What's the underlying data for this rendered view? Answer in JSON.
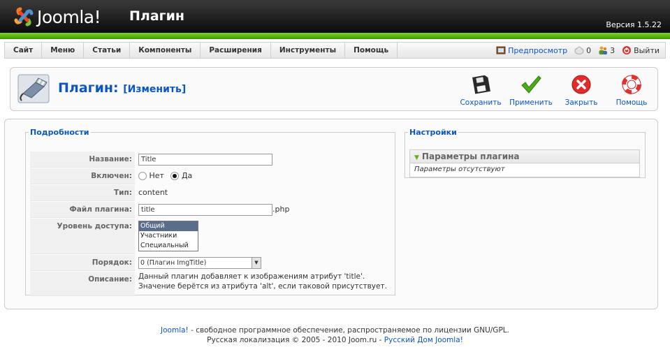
{
  "header": {
    "brand": "Joomla!",
    "brand_trademark": "",
    "page_title": "Плагин",
    "version": "Версия 1.5.22"
  },
  "menu": {
    "items": [
      {
        "label": "Сайт"
      },
      {
        "label": "Меню"
      },
      {
        "label": "Статьи"
      },
      {
        "label": "Компоненты"
      },
      {
        "label": "Расширения"
      },
      {
        "label": "Инструменты"
      },
      {
        "label": "Помощь"
      }
    ]
  },
  "status": {
    "preview_label": "Предпросмотр",
    "messages_count": "0",
    "users_online": "3",
    "logout_label": "Выйти"
  },
  "title": {
    "main": "Плагин:",
    "sub": "[Изменить]"
  },
  "toolbar": {
    "save": "Сохранить",
    "apply": "Применить",
    "close": "Закрыть",
    "help": "Помощь"
  },
  "details": {
    "legend": "Подробности",
    "name_label": "Название:",
    "name_value": "Title",
    "enabled_label": "Включен:",
    "enabled_no": "Нет",
    "enabled_yes": "Да",
    "enabled_selected": "yes",
    "type_label": "Тип:",
    "type_value": "content",
    "file_label": "Файл плагина:",
    "file_value": "title",
    "file_ext": ".php",
    "access_label": "Уровень доступа:",
    "access_options": [
      "Общий",
      "Участники",
      "Специальный"
    ],
    "access_selected": "Общий",
    "order_label": "Порядок:",
    "order_value": "0 (Плагин ImgTitle)",
    "desc_label": "Описание:",
    "desc_text": "Данный плагин добавляет к изображениям атрибут 'title'. Значение берётся из атрибута 'alt', если таковой присутствует."
  },
  "settings": {
    "legend": "Настройки",
    "panel_title": "Параметры плагина",
    "panel_empty": "Параметры отсутствуют"
  },
  "footer": {
    "line1_link": "Joomla!",
    "line1_text": " - свободное программное обеспечение, распространяемое по лицензии GNU/GPL.",
    "line2_text": "Русская локализация © 2005 - 2010 Joom.ru - ",
    "line2_link": "Русский Дом Joomla!"
  },
  "colors": {
    "accent_blue": "#0b55c4",
    "green_bar": "#5bb50f",
    "header_bg": "#1a1a1a",
    "panel_border": "#cccccc"
  },
  "icons": {
    "logo": "joomla-logo-icon",
    "save": "floppy-disk-icon",
    "apply": "green-check-icon",
    "close": "red-close-icon",
    "help": "lifebuoy-icon",
    "plugin": "plugin-icon"
  }
}
